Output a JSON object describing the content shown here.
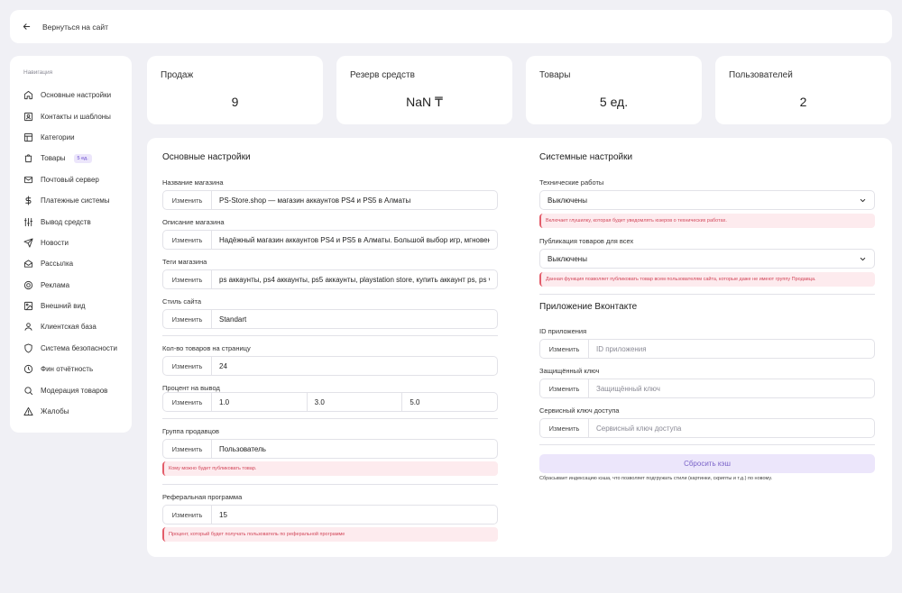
{
  "topbar": {
    "back_label": "Вернуться на сайт"
  },
  "sidebar": {
    "heading": "Навигация",
    "items": [
      {
        "label": "Основные настройки",
        "icon": "home-icon"
      },
      {
        "label": "Контакты и шаблоны",
        "icon": "contact-card-icon"
      },
      {
        "label": "Категории",
        "icon": "categories-icon"
      },
      {
        "label": "Товары",
        "icon": "bag-icon",
        "badge": "5 ед."
      },
      {
        "label": "Почтовый сервер",
        "icon": "mail-icon"
      },
      {
        "label": "Платежные системы",
        "icon": "dollar-icon"
      },
      {
        "label": "Вывод средств",
        "icon": "sliders-icon"
      },
      {
        "label": "Новости",
        "icon": "send-icon"
      },
      {
        "label": "Рассылка",
        "icon": "mail-open-icon"
      },
      {
        "label": "Реклама",
        "icon": "target-icon"
      },
      {
        "label": "Внешний вид",
        "icon": "image-icon"
      },
      {
        "label": "Клиентская база",
        "icon": "user-icon"
      },
      {
        "label": "Система безопасности",
        "icon": "shield-icon"
      },
      {
        "label": "Фин отчётность",
        "icon": "clock-icon"
      },
      {
        "label": "Модерация товаров",
        "icon": "search-icon"
      },
      {
        "label": "Жалобы",
        "icon": "warning-icon"
      }
    ]
  },
  "stats": [
    {
      "label": "Продаж",
      "value": "9"
    },
    {
      "label": "Резерв средств",
      "value": "NaN ₸"
    },
    {
      "label": "Товары",
      "value": "5 ед."
    },
    {
      "label": "Пользователей",
      "value": "2"
    }
  ],
  "main": {
    "edit_label": "Изменить",
    "left": {
      "title": "Основные настройки",
      "shop_name": {
        "label": "Название магазина",
        "value": "PS-Store.shop — магазин аккаунтов PS4 и PS5 в Алматы"
      },
      "shop_description": {
        "label": "Описание магазина",
        "value": "Надёжный магазин аккаунтов PS4 и PS5 в Алматы. Большой выбор игр, мгновенная выдача"
      },
      "shop_tags": {
        "label": "Теги магазина",
        "value": "ps аккаунты, ps4 аккаунты, ps5 аккаунты, playstation store, купить аккаунт ps, ps vault,"
      },
      "site_style": {
        "label": "Стиль сайта",
        "value": "Standart"
      },
      "items_per_page": {
        "label": "Кол-во товаров на страницу",
        "value": "24"
      },
      "withdraw_percent": {
        "label": "Процент на вывод",
        "values": [
          "1.0",
          "3.0",
          "5.0"
        ]
      },
      "seller_group": {
        "label": "Группа продавцов",
        "value": "Пользователь",
        "note": "Кому можно будет публиковать товар."
      },
      "referral": {
        "label": "Реферальная программа",
        "value": "15",
        "note": "Процент, который будет получать пользователь по реферальной программе"
      }
    },
    "right": {
      "title": "Системные настройки",
      "maintenance": {
        "label": "Технические работы",
        "value": "Выключены",
        "note": "Включает глушилку, которая будет уведомлять юзеров о технических работах."
      },
      "publish_all": {
        "label": "Публикация товаров для всех",
        "value": "Выключены",
        "note": "Данная функция позволяет публиковать товар всем пользователям сайта, которые даже не имеют группу Продавца."
      },
      "vk_title": "Приложение Вконтакте",
      "vk_app_id": {
        "label": "ID приложения",
        "placeholder": "ID приложения"
      },
      "vk_secret": {
        "label": "Защищённый ключ",
        "placeholder": "Защищённый ключ"
      },
      "vk_service": {
        "label": "Сервисный ключ доступа",
        "placeholder": "Сервисный ключ доступа"
      },
      "reset_label": "Сбросить кэш",
      "reset_hint": "Сбрасывает индексацию кэша, что позволяет подгружать стили (картинки, скрипты и т.д.) по новому."
    }
  },
  "colors": {
    "accent_bg": "#ece6fb",
    "accent_text": "#7a63c8",
    "danger": "#e35d6a",
    "danger_bg": "#fdebee"
  }
}
